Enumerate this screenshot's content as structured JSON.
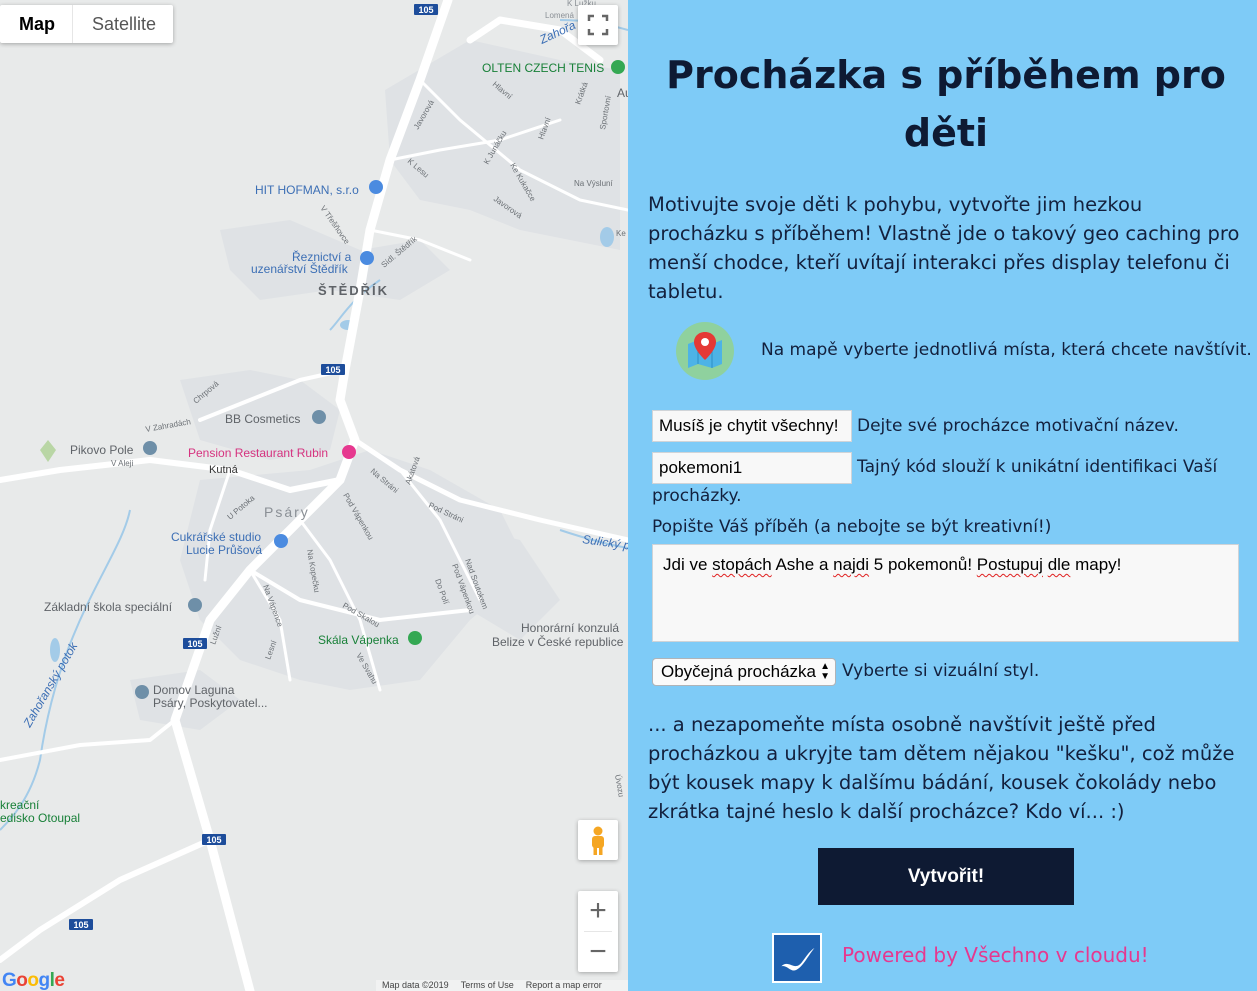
{
  "map": {
    "type_buttons": [
      "Map",
      "Satellite"
    ],
    "road_shields": [
      "105",
      "105",
      "105",
      "105",
      "105"
    ],
    "places": {
      "olten": "OLTEN CZECH TENIS",
      "hit": "HIT HOFMAN, s.r.o",
      "reznictvi": "Řeznictví a",
      "uzenarstvi": "uzenářství Štědřík",
      "stedrik": "ŠTĚDŘÍK",
      "bb": "BB Cosmetics",
      "pikovo": "Pikovo Pole",
      "pension": "Pension Restaurant Rubin",
      "psary": "Psáry",
      "cukrarske1": "Cukrářské studio",
      "cukrarske2": "Lucie Průšová",
      "zakladni": "Základní škola speciální",
      "skala": "Skála Vápenka",
      "honorarni1": "Honorární konzulá",
      "honorarni2": "Belize v České republice",
      "domov1": "Domov Laguna",
      "domov2": "Psáry, Poskytovatel...",
      "rekreacni1": "kreační",
      "rekreacni2": "edisko Otoupal",
      "sulicky": "Sulický p",
      "zahoransky": "Zahořanský potok",
      "zahorany_top": "Zahořa",
      "lomena": "Lomená",
      "luzku": "K Lužku"
    },
    "streets": {
      "javorova": "Javorová",
      "klesu": "K Lesu",
      "vtresnovce": "V Třešňovce",
      "sidlstedrik": "Sídl. Štědřík",
      "kjunacku": "K Junáčku",
      "kekukacka": "Ke Kukačce",
      "hlavni1": "Hlavní",
      "hlavni2": "Hlavní",
      "navysluni": "Na Výsluní",
      "krakta": "Krátká",
      "sportovni": "Sportovní",
      "javorova2": "Javorová",
      "chrpova": "Chrpová",
      "vzahradach": "V Zahradách",
      "valeji": "V Aleji",
      "kutna": "Kutná",
      "nastrani": "Na Stráni",
      "akatova": "Akátová",
      "podstrani": "Pod Stráni",
      "podvapenkou": "Pod Vápenkou",
      "upotoka": "U Potoka",
      "nakopecku": "Na Kopečku",
      "navapence": "Na Vápence",
      "lesni": "Lesní",
      "luzni": "Lužní",
      "podskalou": "Pod Skalou",
      "vesvahu": "Ve Svahu",
      "dopoli": "Do Polí",
      "podvapenkou2": "Pod Vápenkou",
      "nadsoutokem": "Nad Soutokem",
      "uzvozu": "Úvozu",
      "ke": "Ke",
      "au": "Au"
    },
    "attribution": [
      "Map data ©2019",
      "Terms of Use",
      "Report a map error"
    ],
    "logo_letters": [
      "G",
      "o",
      "o",
      "g",
      "l",
      "e"
    ],
    "zoom_in": "+",
    "zoom_out": "−"
  },
  "panel": {
    "title": "Procházka s příběhem pro děti",
    "intro": "Motivujte svoje děti k pohybu, vytvořte jim hezkou procházku s příběhem! Vlastně jde o takový geo caching pro menší chodce, kteří uvítají interakci přes display telefonu či tabletu.",
    "step_text": "Na mapě vyberte jednotlivá místa, která chcete navštívit.",
    "name_value": "Musíš je chytit všechny!",
    "name_hint": "Dejte své procházce motivační název.",
    "code_value": "pokemoni1",
    "code_hint_1": "Tajný kód slouží k unikátní identifikaci Vaší",
    "code_hint_2": "procházky.",
    "story_label": "Popište Váš příběh (a nebojte se být kreativní!)",
    "story_parts": [
      "Jdi ve ",
      "stopách",
      " Ashe a ",
      "najdi",
      " 5 pokemonů! ",
      "Postupuj",
      " ",
      "dle",
      " mapy!"
    ],
    "style_value": "Obyčejná procházka",
    "style_hint": "Vyberte si vizuální styl.",
    "outro": "... a nezapomeňte místa osobně navštívit ještě před procházkou a ukryjte tam dětem nějakou \"kešku\", což může být kousek mapy k dalšímu bádání, kousek čokolády nebo zkrátka tajné heslo k další procházce? Kdo ví... :)",
    "submit": "Vytvořit!",
    "powered": "Powered by Všechno v cloudu!"
  },
  "colors": {
    "panel_bg": "#7ecbf7",
    "title": "#0e1a33",
    "button_bg": "#0e1a33",
    "powered": "#e6388f",
    "road_shield": "#1d4d9b"
  }
}
